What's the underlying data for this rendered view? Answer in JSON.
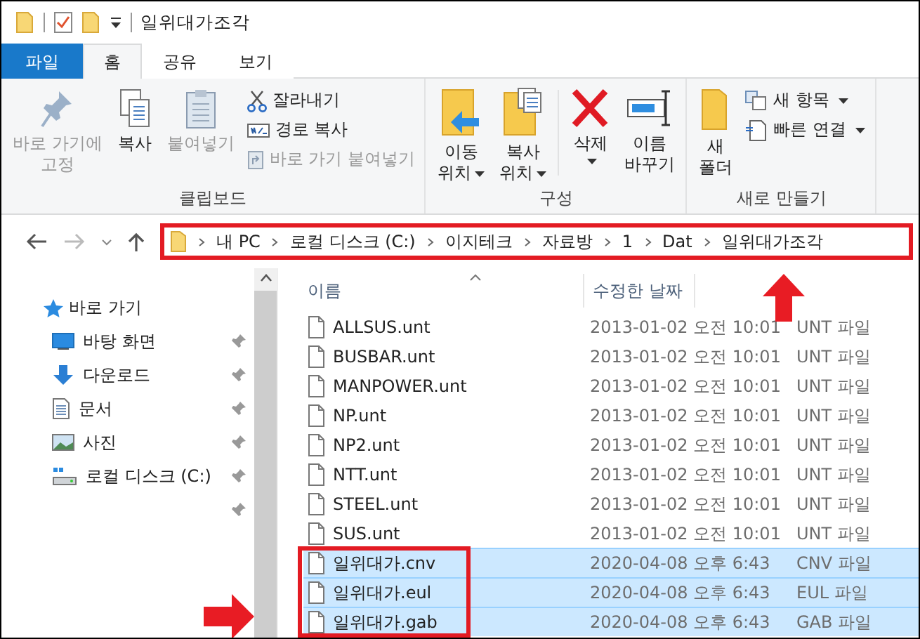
{
  "title_bar": {
    "title": "일위대가조각"
  },
  "tabs": [
    {
      "label": "파일",
      "kind": "file",
      "selected": false
    },
    {
      "label": "홈",
      "kind": "tab",
      "selected": true
    },
    {
      "label": "공유",
      "kind": "tab",
      "selected": false
    },
    {
      "label": "보기",
      "kind": "tab",
      "selected": false
    }
  ],
  "ribbon": {
    "clipboard": {
      "label": "클립보드",
      "pin": {
        "label": "바로 가기에\n고정",
        "disabled": true
      },
      "copy": {
        "label": "복사",
        "disabled": false
      },
      "paste": {
        "label": "붙여넣기",
        "disabled": true
      },
      "cut": {
        "label": "잘라내기",
        "disabled": false
      },
      "copy_path": {
        "label": "경로 복사",
        "disabled": false
      },
      "paste_shortcut": {
        "label": "바로 가기 붙여넣기",
        "disabled": true
      }
    },
    "organize": {
      "label": "구성",
      "move_to": {
        "label": "이동\n위치"
      },
      "copy_to": {
        "label": "복사\n위치"
      },
      "delete": {
        "label": "삭제"
      },
      "rename": {
        "label": "이름\n바꾸기"
      }
    },
    "new": {
      "label": "새로 만들기",
      "new_folder": {
        "label": "새\n폴더"
      },
      "new_item": {
        "label": "새 항목"
      },
      "easy_access": {
        "label": "빠른 연결"
      }
    }
  },
  "address_bar": {
    "segments": [
      "내 PC",
      "로컬 디스크 (C:)",
      "이지테크",
      "자료방",
      "1",
      "Dat",
      "일위대가조각"
    ]
  },
  "sidebar": {
    "quick_access": "바로 가기",
    "items": [
      {
        "label": "바탕 화면",
        "kind": "desktop",
        "pinned": true
      },
      {
        "label": "다운로드",
        "kind": "download",
        "pinned": true
      },
      {
        "label": "문서",
        "kind": "document",
        "pinned": true
      },
      {
        "label": "사진",
        "kind": "picture",
        "pinned": true
      },
      {
        "label": "로컬 디스크 (C:)",
        "kind": "drive",
        "pinned": true
      }
    ]
  },
  "file_list": {
    "columns": [
      "이름",
      "수정한 날짜"
    ],
    "rows": [
      {
        "name": "ALLSUS.unt",
        "date": "2013-01-02 오전 10:01",
        "type": "UNT 파일",
        "selected": false
      },
      {
        "name": "BUSBAR.unt",
        "date": "2013-01-02 오전 10:01",
        "type": "UNT 파일",
        "selected": false
      },
      {
        "name": "MANPOWER.unt",
        "date": "2013-01-02 오전 10:01",
        "type": "UNT 파일",
        "selected": false
      },
      {
        "name": "NP.unt",
        "date": "2013-01-02 오전 10:01",
        "type": "UNT 파일",
        "selected": false
      },
      {
        "name": "NP2.unt",
        "date": "2013-01-02 오전 10:01",
        "type": "UNT 파일",
        "selected": false
      },
      {
        "name": "NTT.unt",
        "date": "2013-01-02 오전 10:01",
        "type": "UNT 파일",
        "selected": false
      },
      {
        "name": "STEEL.unt",
        "date": "2013-01-02 오전 10:01",
        "type": "UNT 파일",
        "selected": false
      },
      {
        "name": "SUS.unt",
        "date": "2013-01-02 오전 10:01",
        "type": "UNT 파일",
        "selected": false
      },
      {
        "name": "일위대가.cnv",
        "date": "2020-04-08 오후 6:43",
        "type": "CNV 파일",
        "selected": true
      },
      {
        "name": "일위대가.eul",
        "date": "2020-04-08 오후 6:43",
        "type": "EUL 파일",
        "selected": true
      },
      {
        "name": "일위대가.gab",
        "date": "2020-04-08 오후 6:43",
        "type": "GAB 파일",
        "selected": true
      }
    ]
  }
}
